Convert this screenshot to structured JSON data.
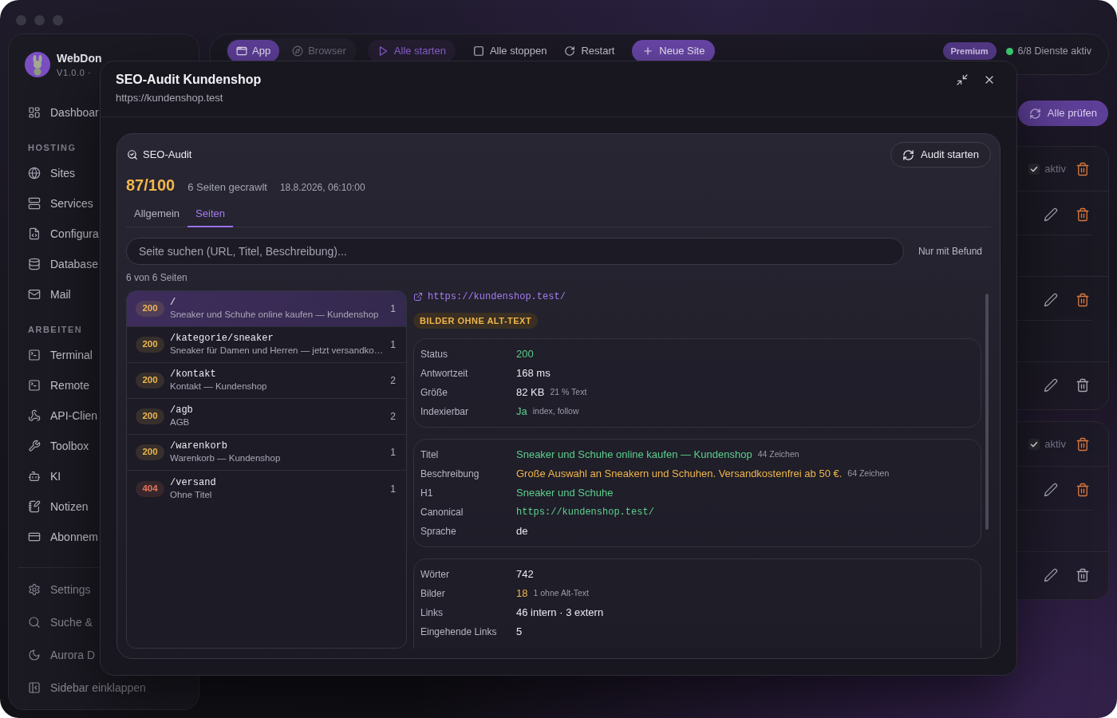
{
  "sidebar": {
    "brand": {
      "name": "WebDon",
      "version": "V1.0.0 ·"
    },
    "sections": [
      {
        "items": [
          {
            "label": "Dashboar",
            "selected": false
          }
        ]
      },
      {
        "heading": "HOSTING",
        "items": [
          {
            "label": "Sites",
            "selected": false
          },
          {
            "label": "Services",
            "selected": false
          },
          {
            "label": "Configura",
            "selected": false
          },
          {
            "label": "Database",
            "selected": false
          },
          {
            "label": "Mail",
            "selected": false
          }
        ]
      },
      {
        "heading": "ARBEITEN",
        "items": [
          {
            "label": "Terminal",
            "selected": false
          },
          {
            "label": "Remote",
            "selected": false
          },
          {
            "label": "API-Clien",
            "selected": false
          },
          {
            "label": "Toolbox",
            "selected": false
          },
          {
            "label": "KI",
            "selected": false
          },
          {
            "label": "Notizen",
            "selected": false
          },
          {
            "label": "Abonnem",
            "selected": false
          }
        ]
      }
    ],
    "footer": [
      {
        "label": "Settings"
      },
      {
        "label": "Suche &"
      },
      {
        "label": "Aurora D"
      },
      {
        "label": "Sidebar einklappen"
      }
    ]
  },
  "toolbar": {
    "view_tabs": [
      {
        "label": "App",
        "selected": true
      },
      {
        "label": "Browser",
        "selected": false
      }
    ],
    "actions": [
      {
        "kind": "start",
        "label": "Alle starten"
      },
      {
        "kind": "plain",
        "label": "Alle stoppen"
      },
      {
        "kind": "plain",
        "label": "Restart"
      },
      {
        "kind": "primary",
        "label": "Neue Site"
      }
    ],
    "plan_badge": "Premium",
    "services_status": "6/8 Dienste aktiv"
  },
  "check_all_button": "Alle prüfen",
  "site_cards": [
    {
      "status": "aktiv",
      "delete_highlighted": true,
      "rows": [
        {
          "delete_highlighted": true
        },
        {
          "delete_highlighted": true
        },
        {
          "delete_highlighted": false
        }
      ]
    },
    {
      "status": "aktiv",
      "delete_highlighted": true,
      "rows": [
        {
          "delete_highlighted": true
        },
        {
          "delete_highlighted": false
        }
      ]
    }
  ],
  "dialog": {
    "title": "SEO-Audit Kundenshop",
    "subtitle": "https://kundenshop.test",
    "panel": {
      "title": "SEO-Audit",
      "run_button": "Audit starten",
      "score": "87/100",
      "pages_crawled": "6 Seiten gecrawlt",
      "timestamp": "18.8.2026, 06:10:00",
      "tabs": [
        {
          "label": "Allgemein",
          "selected": false
        },
        {
          "label": "Seiten",
          "selected": true
        }
      ],
      "search": {
        "placeholder": "Seite suchen (URL, Titel, Beschreibung)..."
      },
      "filter_button": "Nur mit Befund",
      "result_count": "6 von 6 Seiten",
      "pages": [
        {
          "status": "200",
          "color": "#eab552",
          "path": "/",
          "title": "Sneaker und Schuhe online kaufen — Kundenshop",
          "findings": "1",
          "selected": true
        },
        {
          "status": "200",
          "color": "#eab552",
          "path": "/kategorie/sneaker",
          "title": "Sneaker für Damen und Herren — jetzt versandko…",
          "findings": "1",
          "selected": false
        },
        {
          "status": "200",
          "color": "#eab552",
          "path": "/kontakt",
          "title": "Kontakt — Kundenshop",
          "findings": "2",
          "selected": false
        },
        {
          "status": "200",
          "color": "#eab552",
          "path": "/agb",
          "title": "AGB",
          "findings": "2",
          "selected": false
        },
        {
          "status": "200",
          "color": "#eab552",
          "path": "/warenkorb",
          "title": "Warenkorb — Kundenshop",
          "findings": "1",
          "selected": false
        },
        {
          "status": "404",
          "color": "#e5775c",
          "path": "/versand",
          "title": "Ohne Titel",
          "findings": "1",
          "selected": false
        }
      ],
      "detail": {
        "url": "https://kundenshop.test/",
        "issues": [
          "BILDER OHNE ALT-TEXT"
        ],
        "sections": [
          {
            "rows": [
              {
                "kind": "text",
                "label": "Status",
                "value": "200",
                "color": "#5dcf8c"
              },
              {
                "kind": "text",
                "label": "Antwortzeit",
                "value": "168 ms",
                "color": "#ebeaf1"
              },
              {
                "kind": "text",
                "label": "Größe",
                "value": "82 KB",
                "note": "21 % Text",
                "color": "#ebeaf1"
              },
              {
                "kind": "text",
                "label": "Indexierbar",
                "value": "Ja",
                "note": "index, follow",
                "color": "#5dcf8c"
              }
            ]
          },
          {
            "rows": [
              {
                "kind": "text",
                "label": "Titel",
                "value": "Sneaker und Schuhe online kaufen — Kundenshop",
                "note": "44 Zeichen",
                "color": "#5dcf8c"
              },
              {
                "kind": "text",
                "label": "Beschreibung",
                "value": "Große Auswahl an Sneakern und Schuhen. Versandkostenfrei ab 50 €.",
                "note": "64 Zeichen",
                "color": "#f0b54b"
              },
              {
                "kind": "text",
                "label": "H1",
                "value": "Sneaker und Schuhe",
                "color": "#5dcf8c"
              },
              {
                "kind": "code",
                "label": "Canonical",
                "value": "https://kundenshop.test/",
                "color": "#5dcf8c"
              },
              {
                "kind": "text",
                "label": "Sprache",
                "value": "de",
                "color": "#ebeaf1"
              }
            ]
          },
          {
            "rows": [
              {
                "kind": "text",
                "label": "Wörter",
                "value": "742",
                "color": "#ebeaf1"
              },
              {
                "kind": "text",
                "label": "Bilder",
                "value": "18",
                "note": "1 ohne Alt-Text",
                "color": "#f0b54b"
              },
              {
                "kind": "text",
                "label": "Links",
                "value": "46 intern · 3 extern",
                "color": "#ebeaf1"
              },
              {
                "kind": "text",
                "label": "Eingehende Links",
                "value": "5",
                "color": "#ebeaf1"
              }
            ]
          }
        ]
      }
    }
  }
}
